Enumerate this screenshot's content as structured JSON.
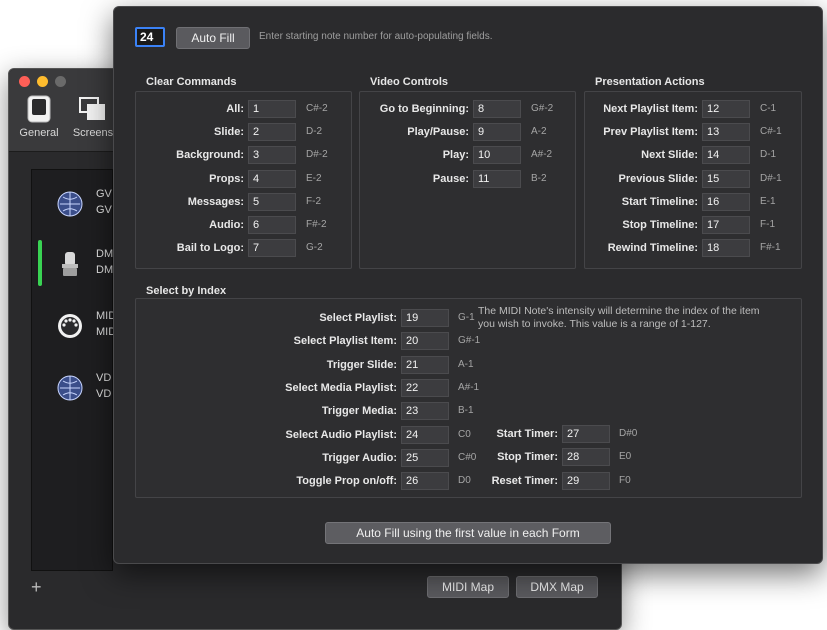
{
  "background_window": {
    "toolbar": [
      {
        "label": "General",
        "icon": "general-icon"
      },
      {
        "label": "Screens",
        "icon": "screens-icon"
      }
    ],
    "devices": [
      {
        "icon": "globe-icon",
        "line1": "GV",
        "line2": "GV",
        "selected": false
      },
      {
        "icon": "moving-head-light-icon",
        "line1": "DM",
        "line2": "DM",
        "selected": true
      },
      {
        "icon": "midi-port-icon",
        "line1": "MID",
        "line2": "MID",
        "selected": false
      },
      {
        "icon": "globe-icon",
        "line1": "VD",
        "line2": "VD",
        "selected": false
      }
    ],
    "add_label": "+",
    "tabs": {
      "midi_map": "MIDI Map",
      "dmx_map": "DMX Map"
    }
  },
  "panel": {
    "start_value": "24",
    "auto_fill_label": "Auto Fill",
    "hint": "Enter starting note number for auto-populating fields.",
    "clear_commands": {
      "title": "Clear Commands",
      "rows": [
        {
          "label": "All:",
          "value": "1",
          "note": "C#-2"
        },
        {
          "label": "Slide:",
          "value": "2",
          "note": "D-2"
        },
        {
          "label": "Background:",
          "value": "3",
          "note": "D#-2"
        },
        {
          "label": "Props:",
          "value": "4",
          "note": "E-2"
        },
        {
          "label": "Messages:",
          "value": "5",
          "note": "F-2"
        },
        {
          "label": "Audio:",
          "value": "6",
          "note": "F#-2"
        },
        {
          "label": "Bail to Logo:",
          "value": "7",
          "note": "G-2"
        }
      ]
    },
    "video_controls": {
      "title": "Video Controls",
      "rows": [
        {
          "label": "Go to Beginning:",
          "value": "8",
          "note": "G#-2"
        },
        {
          "label": "Play/Pause:",
          "value": "9",
          "note": "A-2"
        },
        {
          "label": "Play:",
          "value": "10",
          "note": "A#-2"
        },
        {
          "label": "Pause:",
          "value": "11",
          "note": "B-2"
        }
      ]
    },
    "presentation_actions": {
      "title": "Presentation Actions",
      "rows": [
        {
          "label": "Next Playlist Item:",
          "value": "12",
          "note": "C-1"
        },
        {
          "label": "Prev Playlist Item:",
          "value": "13",
          "note": "C#-1"
        },
        {
          "label": "Next Slide:",
          "value": "14",
          "note": "D-1"
        },
        {
          "label": "Previous Slide:",
          "value": "15",
          "note": "D#-1"
        },
        {
          "label": "Start Timeline:",
          "value": "16",
          "note": "E-1"
        },
        {
          "label": "Stop Timeline:",
          "value": "17",
          "note": "F-1"
        },
        {
          "label": "Rewind Timeline:",
          "value": "18",
          "note": "F#-1"
        }
      ]
    },
    "select_by_index": {
      "title": "Select by Index",
      "rows": [
        {
          "label": "Select Playlist:",
          "value": "19",
          "note": "G-1"
        },
        {
          "label": "Select Playlist Item:",
          "value": "20",
          "note": "G#-1"
        },
        {
          "label": "Trigger Slide:",
          "value": "21",
          "note": "A-1"
        },
        {
          "label": "Select Media Playlist:",
          "value": "22",
          "note": "A#-1"
        },
        {
          "label": "Trigger Media:",
          "value": "23",
          "note": "B-1"
        },
        {
          "label": "Select Audio Playlist:",
          "value": "24",
          "note": "C0"
        },
        {
          "label": "Trigger Audio:",
          "value": "25",
          "note": "C#0"
        },
        {
          "label": "Toggle Prop on/off:",
          "value": "26",
          "note": "D0"
        }
      ],
      "timers": [
        {
          "label": "Start Timer:",
          "value": "27",
          "note": "D#0"
        },
        {
          "label": "Stop Timer:",
          "value": "28",
          "note": "E0"
        },
        {
          "label": "Reset Timer:",
          "value": "29",
          "note": "F0"
        }
      ],
      "description": "The MIDI Note's intensity will determine the index of the item you wish to invoke. This value is a range of 1-127."
    },
    "auto_fill_first_label": "Auto Fill using the first value in each Form"
  }
}
